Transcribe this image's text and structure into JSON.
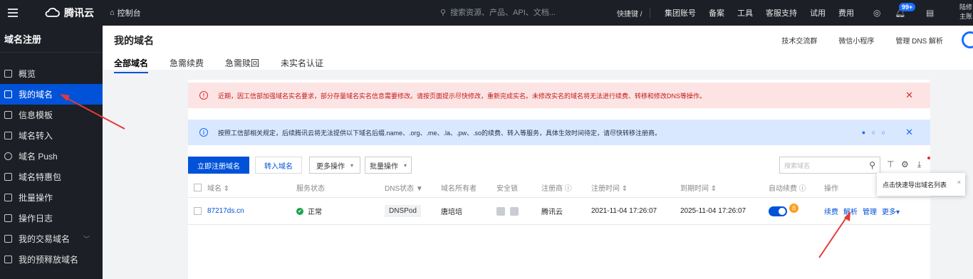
{
  "topbar": {
    "logo_text": "腾讯云",
    "console_label": "控制台",
    "search_placeholder": "搜索资源、产品、API、文档...",
    "shortcut": "快捷键 /",
    "nav": [
      "集团账号",
      "备案",
      "工具",
      "客服支持",
      "试用",
      "费用"
    ],
    "badge": "99+",
    "user_line1": "陆修",
    "user_line2": "主账"
  },
  "sidebar": {
    "title": "域名注册",
    "items": [
      {
        "label": "概览",
        "icon": "grid-icon"
      },
      {
        "label": "我的域名",
        "icon": "window-icon"
      },
      {
        "label": "信息模板",
        "icon": "document-icon"
      },
      {
        "label": "域名转入",
        "icon": "transfer-icon"
      },
      {
        "label": "域名 Push",
        "icon": "push-icon"
      },
      {
        "label": "域名特惠包",
        "icon": "gift-icon"
      },
      {
        "label": "批量操作",
        "icon": "copy-icon"
      },
      {
        "label": "操作日志",
        "icon": "calendar-icon"
      },
      {
        "label": "我的交易域名",
        "icon": "trade-icon"
      },
      {
        "label": "我的预释放域名",
        "icon": "release-icon"
      }
    ]
  },
  "header": {
    "title": "我的域名",
    "links": [
      "技术交流群",
      "微信小程序",
      "管理 DNS 解析"
    ],
    "tabs": [
      "全部域名",
      "急需续费",
      "急需赎回",
      "未实名认证"
    ]
  },
  "alerts": {
    "red": "近期，因工信部加强域名实名要求，部分存量域名实名信息需要修改。请按页面提示尽快修改，重新完成实名。未修改实名的域名将无法进行续费、转移和修改DNS等操作。",
    "blue": "按照工信部相关规定，后续腾讯云将无法提供以下域名后缀.name、.org、.me、.la、.pw、.so的续费、转入等服务，具体生效时间待定，请尽快转移注册商。",
    "dots": "● ○ ○"
  },
  "toolbar": {
    "register": "立即注册域名",
    "transfer": "转入域名",
    "more": "更多操作",
    "batch": "批量操作",
    "search_placeholder": "搜索域名"
  },
  "table": {
    "headers": [
      "域名 ⇕",
      "服务状态",
      "DNS状态 ▼",
      "域名所有者",
      "安全锁",
      "注册商 ⓘ",
      "注册时间 ⇕",
      "到期时间 ⇕",
      "自动续费 ⓘ",
      "操作"
    ],
    "rows": [
      {
        "domain": "87217ds.cn",
        "status": "正常",
        "dns": "DNSPod",
        "owner": "唐培培",
        "registrar": "腾讯云",
        "registered": "2021-11-04 17:26:07",
        "expires": "2025-11-04 17:26:07",
        "auto_renew": true,
        "coin": "币",
        "ops": [
          "续费",
          "解析",
          "管理",
          "更多▾"
        ]
      }
    ]
  },
  "tooltip": {
    "text": "点击快速导出域名列表",
    "close": "×"
  },
  "colors": {
    "primary": "#0052d9",
    "topbar": "#1c1f26",
    "alert_red": "#fde4e4",
    "alert_blue": "#d9e8ff",
    "annotation_arrow": "#e53935"
  }
}
